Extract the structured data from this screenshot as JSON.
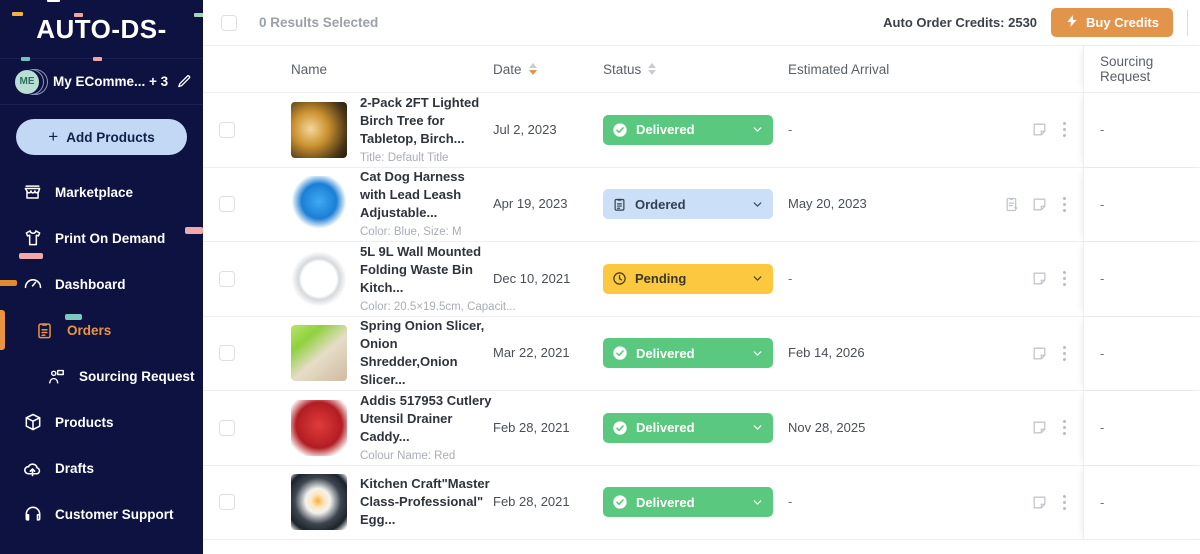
{
  "brand": {
    "name": "AUTO-DS-"
  },
  "sidebar": {
    "profile": {
      "initials": "ME",
      "name": "My EComme... + 3",
      "edit_icon": "pencil-icon"
    },
    "add_products": {
      "label": "Add Products",
      "icon": "plus-icon"
    },
    "items": [
      {
        "label": "Marketplace",
        "icon": "store-icon",
        "active": false
      },
      {
        "label": "Print On Demand",
        "icon": "tshirt-icon",
        "active": false
      },
      {
        "label": "Dashboard",
        "icon": "gauge-icon",
        "active": false
      },
      {
        "label": "Orders",
        "icon": "clipboard-icon",
        "active": true
      },
      {
        "label": "Sourcing Request",
        "icon": "sourcing-icon",
        "active": false
      },
      {
        "label": "Products",
        "icon": "box-icon",
        "active": false
      },
      {
        "label": "Drafts",
        "icon": "cloud-up-icon",
        "active": false
      },
      {
        "label": "Customer Support",
        "icon": "headset-icon",
        "active": false
      }
    ]
  },
  "topbar": {
    "select_all_checkbox": false,
    "results_selected": "0 Results Selected",
    "credits_label": "Auto Order Credits: 2530",
    "buy_credits_label": "Buy Credits",
    "buy_credits_icon": "bolt-icon"
  },
  "table": {
    "columns": [
      {
        "key": "name",
        "label": "Name",
        "sortable": false
      },
      {
        "key": "date",
        "label": "Date",
        "sortable": true,
        "sort": "desc"
      },
      {
        "key": "status",
        "label": "Status",
        "sortable": true,
        "sort": "none"
      },
      {
        "key": "eta",
        "label": "Estimated Arrival",
        "sortable": false
      },
      {
        "key": "sourcing",
        "label": "Sourcing Request",
        "sortable": false
      }
    ],
    "rows": [
      {
        "selected": false,
        "thumb": "birch-tree-lamp-thumbnail",
        "title": "2-Pack 2FT Lighted Birch Tree for Tabletop, Birch...",
        "variant": "Title: Default Title",
        "date": "Jul 2, 2023",
        "status": {
          "label": "Delivered",
          "kind": "delivered",
          "icon": "check-circle-icon"
        },
        "eta": "-",
        "has_auto_order_icon": false,
        "note_icon": "note-icon",
        "menu_icon": "kebab-icon",
        "sourcing": "-"
      },
      {
        "selected": false,
        "thumb": "blue-dog-harness-thumbnail",
        "title": "Cat Dog Harness with Lead Leash Adjustable...",
        "variant": "Color: Blue, Size: M",
        "date": "Apr 19, 2023",
        "status": {
          "label": "Ordered",
          "kind": "ordered",
          "icon": "clipboard-icon"
        },
        "eta": "May 20, 2023",
        "has_auto_order_icon": true,
        "auto_order_icon": "auto-order-icon",
        "note_icon": "note-icon",
        "menu_icon": "kebab-icon",
        "sourcing": "-"
      },
      {
        "selected": false,
        "thumb": "waste-bin-thumbnail",
        "title": "5L 9L Wall Mounted Folding Waste Bin Kitch...",
        "variant": "Color: 20.5×19.5cm, Capacit...",
        "date": "Dec 10, 2021",
        "status": {
          "label": "Pending",
          "kind": "pending",
          "icon": "clock-icon"
        },
        "eta": "-",
        "has_auto_order_icon": false,
        "note_icon": "note-icon",
        "menu_icon": "kebab-icon",
        "sourcing": "-"
      },
      {
        "selected": false,
        "thumb": "onion-slicer-thumbnail",
        "title": "Spring Onion Slicer, Onion Shredder,Onion Slicer...",
        "variant": "",
        "date": "Mar 22, 2021",
        "status": {
          "label": "Delivered",
          "kind": "delivered",
          "icon": "check-circle-icon"
        },
        "eta": "Feb 14, 2026",
        "has_auto_order_icon": false,
        "note_icon": "note-icon",
        "menu_icon": "kebab-icon",
        "sourcing": "-"
      },
      {
        "selected": false,
        "thumb": "red-cutlery-drainer-thumbnail",
        "title": "Addis 517953 Cutlery Utensil Drainer Caddy...",
        "variant": "Colour Name: Red",
        "date": "Feb 28, 2021",
        "status": {
          "label": "Delivered",
          "kind": "delivered",
          "icon": "check-circle-icon"
        },
        "eta": "Nov 28, 2025",
        "has_auto_order_icon": false,
        "note_icon": "note-icon",
        "menu_icon": "kebab-icon",
        "sourcing": "-"
      },
      {
        "selected": false,
        "thumb": "egg-pan-thumbnail",
        "title": "Kitchen Craft\"Master Class-Professional\" Egg...",
        "variant": "",
        "date": "Feb 28, 2021",
        "status": {
          "label": "Delivered",
          "kind": "delivered",
          "icon": "check-circle-icon"
        },
        "eta": "-",
        "has_auto_order_icon": false,
        "note_icon": "note-icon",
        "menu_icon": "kebab-icon",
        "sourcing": "-"
      }
    ]
  },
  "colors": {
    "sidebar_bg": "#0d1240",
    "accent_orange": "#e3944b",
    "active_nav": "#e9943f",
    "delivered": "#5ac97f",
    "ordered": "#cbdff8",
    "pending": "#fbc840",
    "add_products_bg": "#c3d8f5"
  }
}
